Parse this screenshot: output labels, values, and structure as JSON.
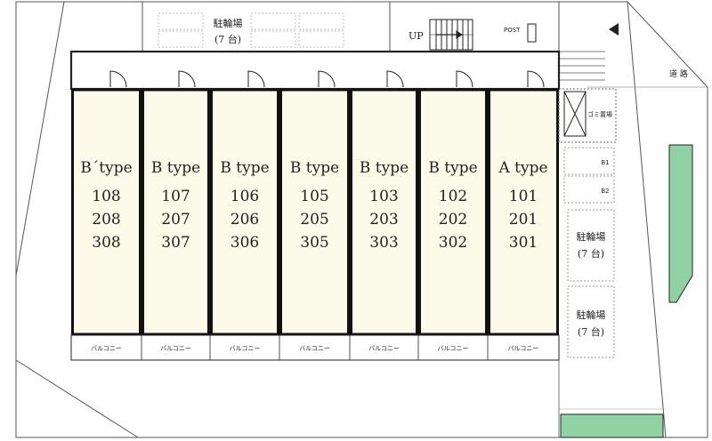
{
  "labels": {
    "up": "UP",
    "post": "POST",
    "road": "道 路",
    "trash": "ゴミ置場",
    "b1": "B1",
    "b2": "B2",
    "bike_top_1": "駐輪場",
    "bike_top_2": "(7 台)",
    "bike_right1_1": "駐輪場",
    "bike_right1_2": "(7 台)",
    "bike_right2_1": "駐輪場",
    "bike_right2_2": "(7 台)"
  },
  "units": [
    {
      "type": "B´type",
      "numbers": [
        "108",
        "208",
        "308"
      ],
      "balcony": "バルコニー"
    },
    {
      "type": "B type",
      "numbers": [
        "107",
        "207",
        "307"
      ],
      "balcony": "バルコニー"
    },
    {
      "type": "B type",
      "numbers": [
        "106",
        "206",
        "306"
      ],
      "balcony": "バルコニー"
    },
    {
      "type": "B type",
      "numbers": [
        "105",
        "205",
        "305"
      ],
      "balcony": "バルコニー"
    },
    {
      "type": "B type",
      "numbers": [
        "103",
        "203",
        "303"
      ],
      "balcony": "バルコニー"
    },
    {
      "type": "B type",
      "numbers": [
        "102",
        "202",
        "302"
      ],
      "balcony": "バルコニー"
    },
    {
      "type": "A type",
      "numbers": [
        "101",
        "201",
        "301"
      ],
      "balcony": "バルコニー"
    }
  ],
  "colors": {
    "unit_fill": "#fcfbe9",
    "green_area": "#8fd3a4",
    "outline": "#222222",
    "light_line": "#999999"
  }
}
